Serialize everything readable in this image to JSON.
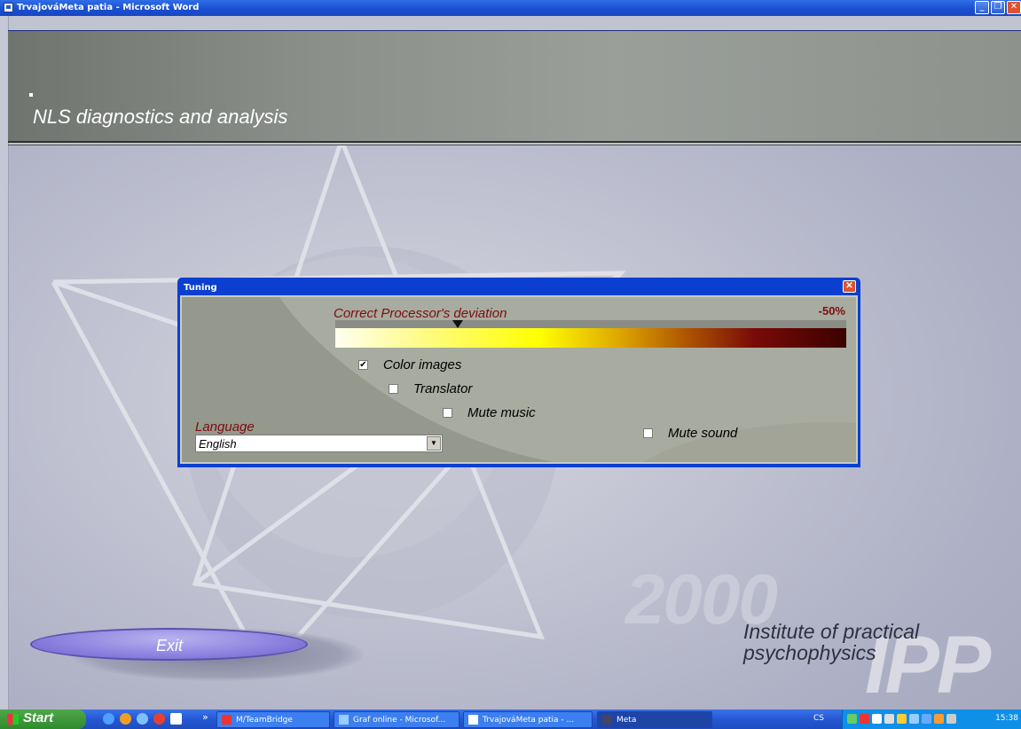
{
  "window": {
    "title": "TrvajováMeta patia - Microsoft Word",
    "controls": [
      "minimize",
      "restore",
      "close"
    ]
  },
  "app": {
    "header_title": "NLS diagnostics and analysis",
    "exit_label": "Exit",
    "brand_year": "2000",
    "brand_short": "IPP",
    "brand_institute_line1": "Institute of practical",
    "brand_institute_line2": "psychophysics"
  },
  "dialog": {
    "title": "Tuning",
    "deviation_label": "Correct Processor's deviation",
    "deviation_value": "-50%",
    "deviation_level_fraction": 0.24,
    "options": [
      {
        "label": "Color images",
        "checked": true
      },
      {
        "label": "Translator",
        "checked": false
      },
      {
        "label": "Mute music",
        "checked": false
      },
      {
        "label": "Mute sound",
        "checked": false
      }
    ],
    "language_label": "Language",
    "language_value": "English"
  },
  "taskbar": {
    "start_label": "Start",
    "quicklaunch_more": "»",
    "buttons": [
      {
        "label": "M/TeamBridge",
        "icon": "gmail-icon",
        "active": false
      },
      {
        "label": "Graf online - Microsof...",
        "icon": "ie-icon",
        "active": false
      },
      {
        "label": "TrvajováMeta patia - ...",
        "icon": "word-icon",
        "active": false
      },
      {
        "label": "Meta",
        "icon": "app-icon",
        "active": true
      }
    ],
    "language_indicator": "CS",
    "clock": "15:38"
  },
  "colors": {
    "titlebar": "#1a4fd1",
    "dialog_accent": "#7a0e10",
    "exit_button": "#8f84e0",
    "header": "#8a8f8a"
  }
}
